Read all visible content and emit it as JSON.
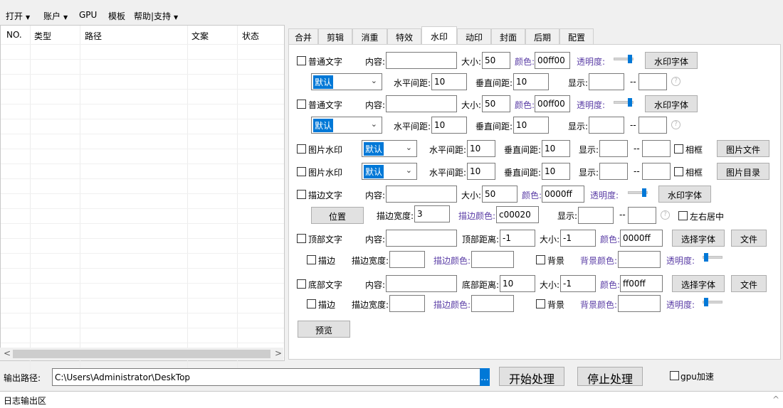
{
  "menu": {
    "open": "打开",
    "account": "账户",
    "gpu": "GPU",
    "template": "模板",
    "help": "帮助|支持",
    "arrow": "▼"
  },
  "table": {
    "columns": [
      "NO.",
      "类型",
      "路径",
      "文案",
      "状态"
    ],
    "scroll_left": "<",
    "scroll_right": ">"
  },
  "tabs": [
    "合并",
    "剪辑",
    "消重",
    "特效",
    "水印",
    "动印",
    "封面",
    "后期",
    "配置"
  ],
  "active_tab": "水印",
  "watermark": {
    "row1": {
      "check": "普通文字",
      "content_label": "内容:",
      "content": "",
      "size_label": "大小:",
      "size": "50",
      "color_label": "颜色:",
      "color": "00ff00",
      "opacity_label": "透明度:",
      "font_btn": "水印字体"
    },
    "row2": {
      "select": "默认",
      "hgap_label": "水平间距:",
      "hgap": "10",
      "vgap_label": "垂直间距:",
      "vgap": "10",
      "show_label": "显示:",
      "show_from": "",
      "dash": "--",
      "show_to": "",
      "help": "?"
    },
    "row3": {
      "check": "普通文字",
      "content_label": "内容:",
      "content": "",
      "size_label": "大小:",
      "size": "50",
      "color_label": "颜色:",
      "color": "00ff00",
      "opacity_label": "透明度:",
      "font_btn": "水印字体"
    },
    "row4": {
      "select": "默认",
      "hgap_label": "水平间距:",
      "hgap": "10",
      "vgap_label": "垂直间距:",
      "vgap": "10",
      "show_label": "显示:",
      "show_from": "",
      "dash": "--",
      "show_to": "",
      "help": "?"
    },
    "row5": {
      "check": "图片水印",
      "select": "默认",
      "hgap_label": "水平间距:",
      "hgap": "10",
      "vgap_label": "垂直间距:",
      "vgap": "10",
      "show_label": "显示:",
      "dash": "--",
      "frame": "相框",
      "btn": "图片文件"
    },
    "row6": {
      "check": "图片水印",
      "select": "默认",
      "hgap_label": "水平间距:",
      "hgap": "10",
      "vgap_label": "垂直间距:",
      "vgap": "10",
      "show_label": "显示:",
      "dash": "--",
      "frame": "相框",
      "btn": "图片目录"
    },
    "row7": {
      "check": "描边文字",
      "content_label": "内容:",
      "content": "",
      "size_label": "大小:",
      "size": "50",
      "color_label": "颜色:",
      "color": "0000ff",
      "opacity_label": "透明度:",
      "font_btn": "水印字体"
    },
    "row8": {
      "pos_btn": "位置",
      "stroke_w_label": "描边宽度:",
      "stroke_w": "3",
      "stroke_c_label": "描边颜色:",
      "stroke_c": "c00020",
      "show_label": "显示:",
      "dash": "--",
      "help": "?",
      "center": "左右居中"
    },
    "row9": {
      "check": "顶部文字",
      "content_label": "内容:",
      "content": "",
      "dist_label": "顶部距离:",
      "dist": "-1",
      "size_label": "大小:",
      "size": "-1",
      "color_label": "颜色:",
      "color": "0000ff",
      "font_btn": "选择字体",
      "file_btn": "文件"
    },
    "row10": {
      "stroke": "描边",
      "stroke_w_label": "描边宽度:",
      "stroke_c_label": "描边颜色:",
      "bg": "背景",
      "bg_c_label": "背景颜色:",
      "opacity_label": "透明度:"
    },
    "row11": {
      "check": "底部文字",
      "content_label": "内容:",
      "content": "",
      "dist_label": "底部距离:",
      "dist": "10",
      "size_label": "大小:",
      "size": "-1",
      "color_label": "颜色:",
      "color": "ff00ff",
      "font_btn": "选择字体",
      "file_btn": "文件"
    },
    "row12": {
      "stroke": "描边",
      "stroke_w_label": "描边宽度:",
      "stroke_c_label": "描边颜色:",
      "bg": "背景",
      "bg_c_label": "背景颜色:",
      "opacity_label": "透明度:"
    },
    "preview": "预览"
  },
  "bottom": {
    "output_label": "输出路径:",
    "output_path": "C:\\Users\\Administrator\\DeskTop",
    "browse": "...",
    "start": "开始处理",
    "stop": "停止处理",
    "gpu_accel": "gpu加速",
    "log_label": "日志输出区",
    "log_scroll": "^"
  }
}
